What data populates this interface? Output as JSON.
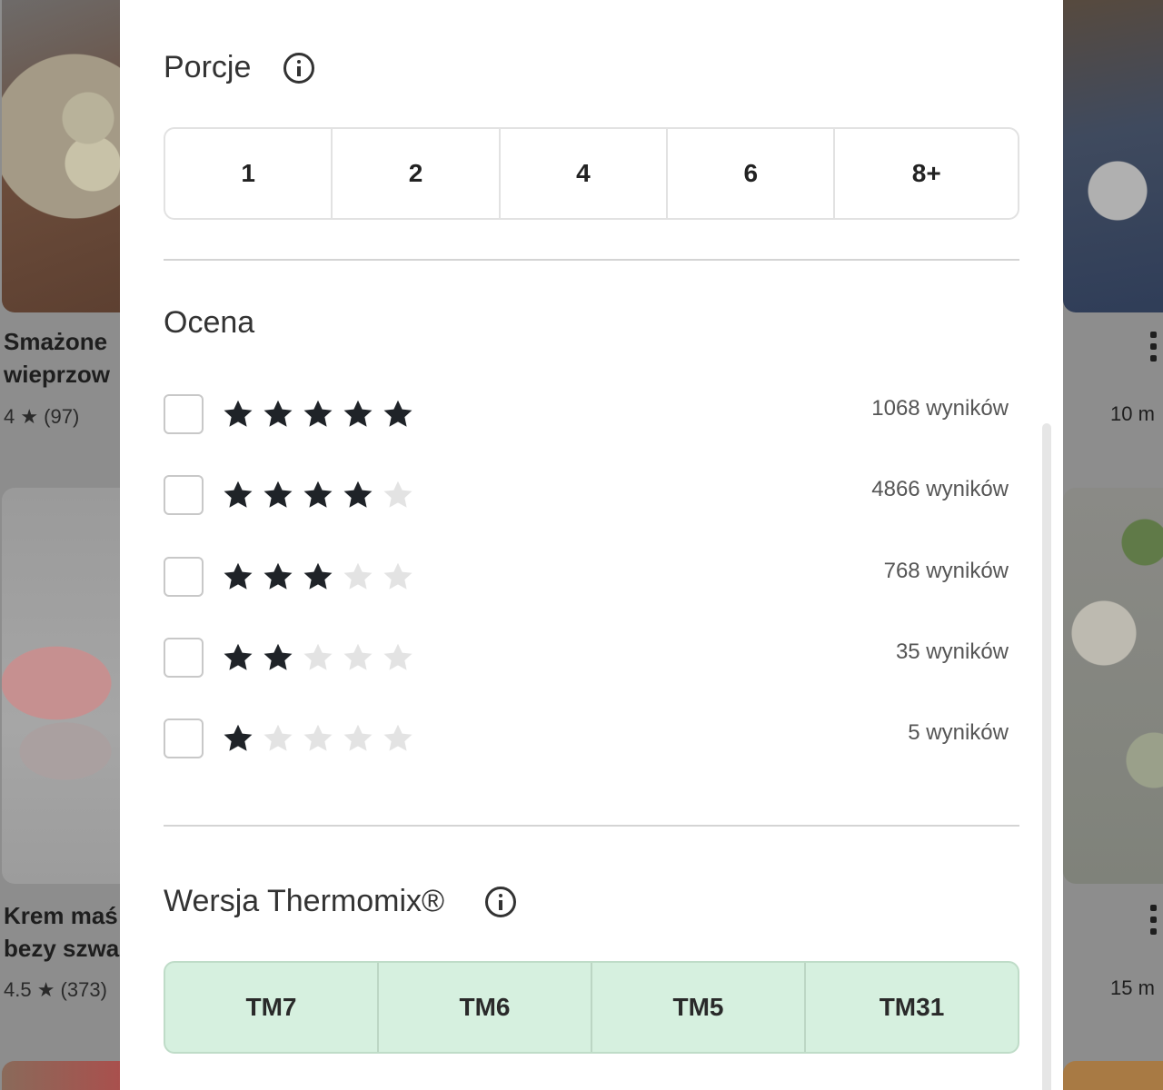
{
  "background_cards": {
    "left": [
      {
        "title_line1": "Smażone",
        "title_line2": "wieprzow",
        "rating_text": "4 ★ (97)"
      },
      {
        "title_line1": "Krem maś",
        "title_line2": "bezy szwa",
        "rating_text": "4.5 ★ (373)"
      }
    ],
    "right": [
      {
        "time": "10 m"
      },
      {
        "time": "15 m"
      }
    ]
  },
  "filters": {
    "portions": {
      "title": "Porcje",
      "options": [
        "1",
        "2",
        "4",
        "6",
        "8+"
      ]
    },
    "rating": {
      "title": "Ocena",
      "rows": [
        {
          "stars": 5,
          "count": "1068 wyników"
        },
        {
          "stars": 4,
          "count": "4866 wyników"
        },
        {
          "stars": 3,
          "count": "768 wyników"
        },
        {
          "stars": 2,
          "count": "35 wyników"
        },
        {
          "stars": 1,
          "count": "5 wyników"
        }
      ]
    },
    "version": {
      "title": "Wersja Thermomix®",
      "options": [
        "TM7",
        "TM6",
        "TM5",
        "TM31"
      ]
    }
  },
  "colors": {
    "star_filled": "#1f2328",
    "star_empty": "#e3e3e3",
    "version_selected_bg": "#d6f0df"
  }
}
